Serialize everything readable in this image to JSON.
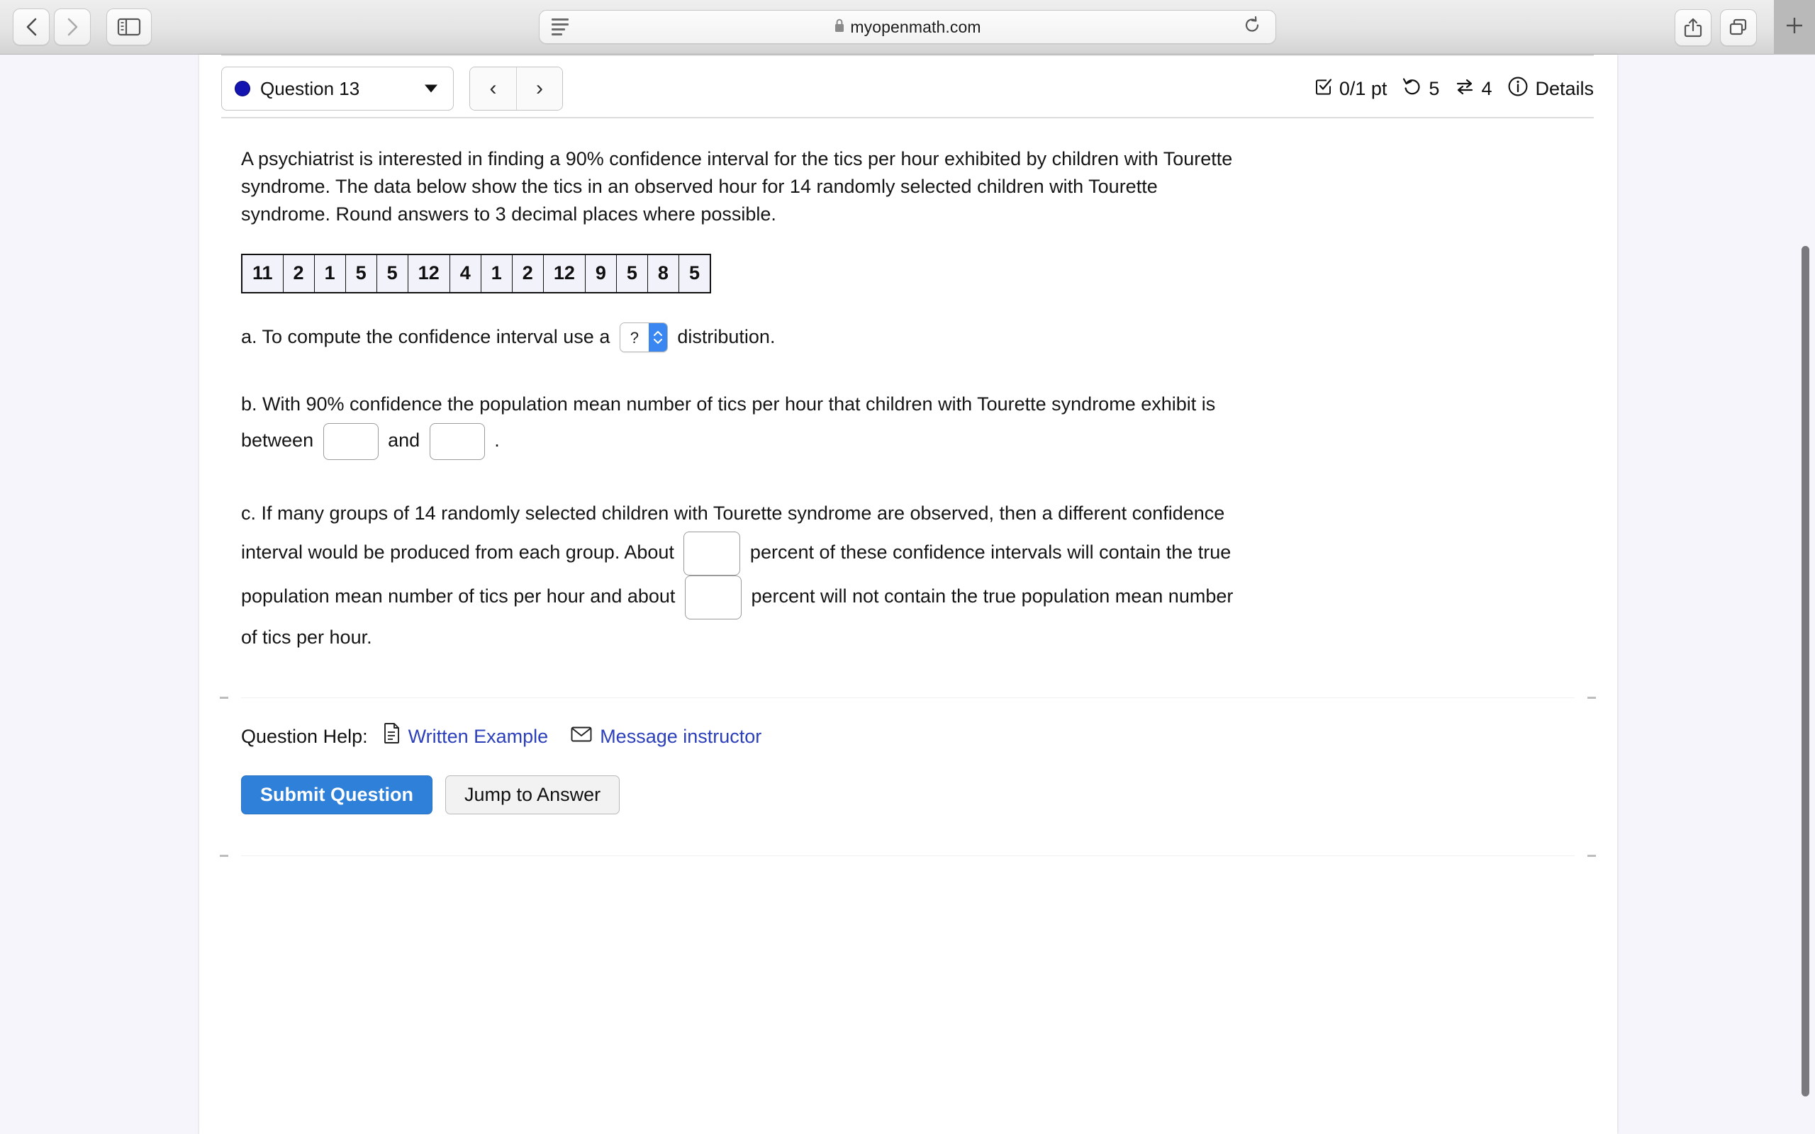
{
  "browser": {
    "back_icon": "chevron-left-icon",
    "forward_icon": "chevron-right-icon",
    "sidebar_icon": "sidebar-toggle-icon",
    "reader_icon": "reader-view-icon",
    "lock_icon": "lock-icon",
    "url": "myopenmath.com",
    "reload_icon": "reload-icon",
    "share_icon": "share-icon",
    "tabs_icon": "tab-overview-icon",
    "new_tab_icon": "plus-icon"
  },
  "question_header": {
    "selector_label": "Question 13",
    "selector_dot_color": "#1414b0",
    "prev_label": "‹",
    "next_label": "›",
    "status": {
      "score_icon": "checkbox-checked-icon",
      "score": "0/1 pt",
      "attempts_icon": "undo-arrow-icon",
      "attempts": "5",
      "versions_icon": "swap-arrows-icon",
      "versions": "4",
      "details_icon": "info-circle-icon",
      "details_label": "Details"
    }
  },
  "question": {
    "prompt": "A psychiatrist is interested in finding a 90% confidence interval for the tics per hour exhibited by children with Tourette syndrome. The data below show the tics in an observed hour for 14 randomly selected children with Tourette syndrome. Round answers to 3 decimal places where possible.",
    "data_values": [
      "11",
      "2",
      "1",
      "5",
      "5",
      "12",
      "4",
      "1",
      "2",
      "12",
      "9",
      "5",
      "8",
      "5"
    ],
    "part_a": {
      "text_before": "a. To compute the confidence interval use a",
      "select_value": "?",
      "text_after": "distribution."
    },
    "part_b": {
      "text_1": "b. With 90% confidence the population mean number of tics per hour that children with Tourette syndrome exhibit is between",
      "input_1": "",
      "text_2": "and",
      "input_2": "",
      "text_3": "."
    },
    "part_c": {
      "text_1": "c. If many groups of 14 randomly selected  children with Tourette syndrome are observed, then a different confidence interval would be produced from each group. About",
      "input_1": "",
      "text_2": "percent of these confidence intervals will contain the true population mean number of tics per hour and about",
      "input_2": "",
      "text_3": "percent will not contain the true population mean number of tics per hour."
    }
  },
  "help": {
    "label": "Question Help:",
    "written_example_icon": "document-icon",
    "written_example": "Written Example",
    "message_icon": "envelope-icon",
    "message_instructor": "Message instructor",
    "link_color": "#2b3fbb"
  },
  "actions": {
    "submit": "Submit Question",
    "jump": "Jump to Answer",
    "submit_color": "#2f80d8"
  }
}
